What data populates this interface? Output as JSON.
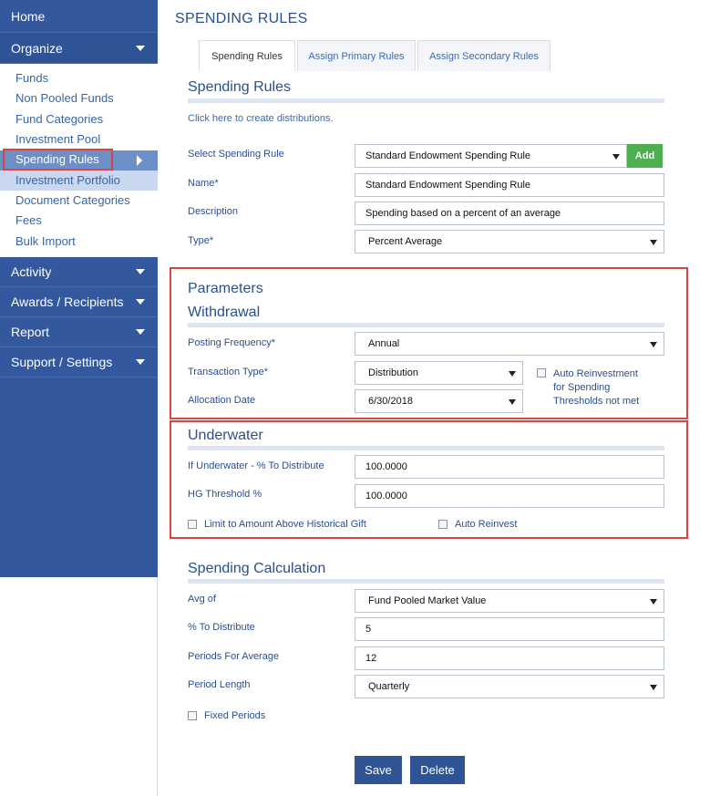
{
  "sidebar": {
    "home": "Home",
    "organize": "Organize",
    "sub_items": [
      "Funds",
      "Non Pooled Funds",
      "Fund Categories",
      "Investment Pool",
      "Spending Rules",
      "Investment Portfolio",
      "Document Categories",
      "Fees",
      "Bulk Import"
    ],
    "activity": "Activity",
    "awards": "Awards / Recipients",
    "report": "Report",
    "support": "Support / Settings"
  },
  "page": {
    "title": "SPENDING RULES",
    "tabs": [
      "Spending Rules",
      "Assign Primary Rules",
      "Assign Secondary Rules"
    ],
    "section_heading": "Spending Rules",
    "create_link": "Click here to create distributions."
  },
  "form": {
    "select_rule_label": "Select Spending Rule",
    "select_rule_value": "Standard Endowment Spending Rule",
    "add_label": "Add",
    "name_label": "Name*",
    "name_value": "Standard Endowment Spending Rule",
    "description_label": "Description",
    "description_value": "Spending based on a percent of an average",
    "type_label": "Type*",
    "type_value": "Percent Average"
  },
  "parameters": {
    "heading": "Parameters",
    "withdrawal_heading": "Withdrawal",
    "posting_frequency_label": "Posting Frequency*",
    "posting_frequency_value": "Annual",
    "transaction_type_label": "Transaction Type*",
    "transaction_type_value": "Distribution",
    "auto_reinvest_label_1": "Auto Reinvestment",
    "auto_reinvest_label_2": "for Spending",
    "auto_reinvest_label_3": "Thresholds not met",
    "allocation_date_label": "Allocation Date",
    "allocation_date_value": "6/30/2018"
  },
  "underwater": {
    "heading": "Underwater",
    "pct_label": "If Underwater - % To Distribute",
    "pct_value": "100.0000",
    "hg_label": "HG Threshold %",
    "hg_value": "100.0000",
    "limit_label": "Limit to Amount Above Historical Gift",
    "auto_reinvest_label": "Auto Reinvest"
  },
  "calculation": {
    "heading": "Spending Calculation",
    "avg_of_label": "Avg of",
    "avg_of_value": "Fund Pooled Market Value",
    "pct_distribute_label": "% To Distribute",
    "pct_distribute_value": "5",
    "periods_label": "Periods For Average",
    "periods_value": "12",
    "period_length_label": "Period Length",
    "period_length_value": "Quarterly",
    "fixed_periods_label": "Fixed Periods"
  },
  "actions": {
    "save": "Save",
    "delete": "Delete"
  },
  "colors": {
    "sidebar": "#34589e",
    "accent": "#2f5496",
    "add_button": "#4caf50",
    "highlight": "#d9443f"
  }
}
